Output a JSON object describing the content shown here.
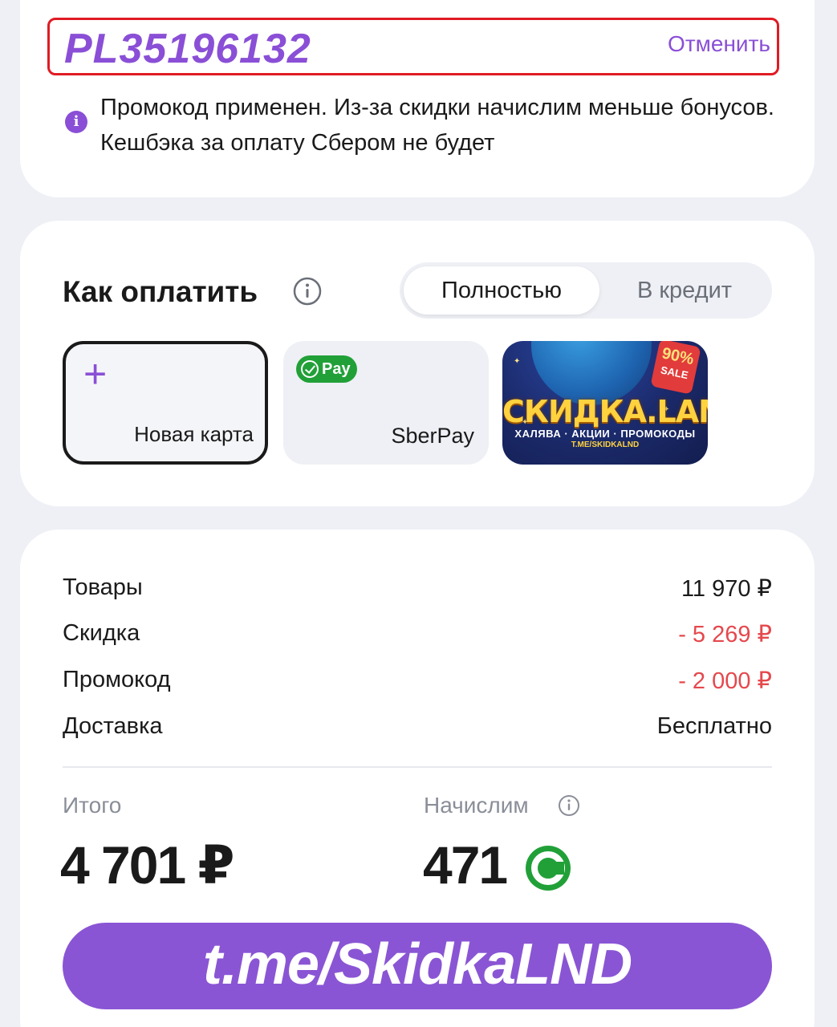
{
  "promo": {
    "code": "PL35196132",
    "cancel_label": "Отменить",
    "note": "Промокод применен. Из-за скидки начислим меньше бонусов. Кешбэка за оплату Сбером не будет"
  },
  "payment": {
    "title": "Как оплатить",
    "tabs": [
      {
        "label": "Полностью",
        "active": true
      },
      {
        "label": "В кредит",
        "active": false
      }
    ],
    "methods": [
      {
        "label": "Новая карта",
        "icon": "plus-icon"
      },
      {
        "label": "SberPay",
        "badge": "Pay",
        "icon": "sberpay-icon"
      }
    ],
    "ad": {
      "title": "СКИДКА.LAND",
      "subtitle": "ХАЛЯВА · АКЦИИ · ПРОМОКОДЫ",
      "url": "T.ME/SKIDKALND",
      "tag_percent": "90%",
      "tag_text": "SALE"
    }
  },
  "summary": {
    "rows": [
      {
        "label": "Товары",
        "value": "11 970 ₽"
      },
      {
        "label": "Скидка",
        "value": "- 5 269 ₽"
      },
      {
        "label": "Промокод",
        "value": "- 2 000 ₽"
      },
      {
        "label": "Доставка",
        "value": "Бесплатно"
      }
    ],
    "total_label": "Итого",
    "total_value": "4 701 ₽",
    "bonus_label": "Начислим",
    "bonus_value": "471",
    "cta_label": "t.me/SkidkaLND"
  },
  "colors": {
    "accent": "#8a4fd6",
    "negative": "#e5484d",
    "sber_green": "#21a038",
    "highlight_border": "#e01b24"
  }
}
